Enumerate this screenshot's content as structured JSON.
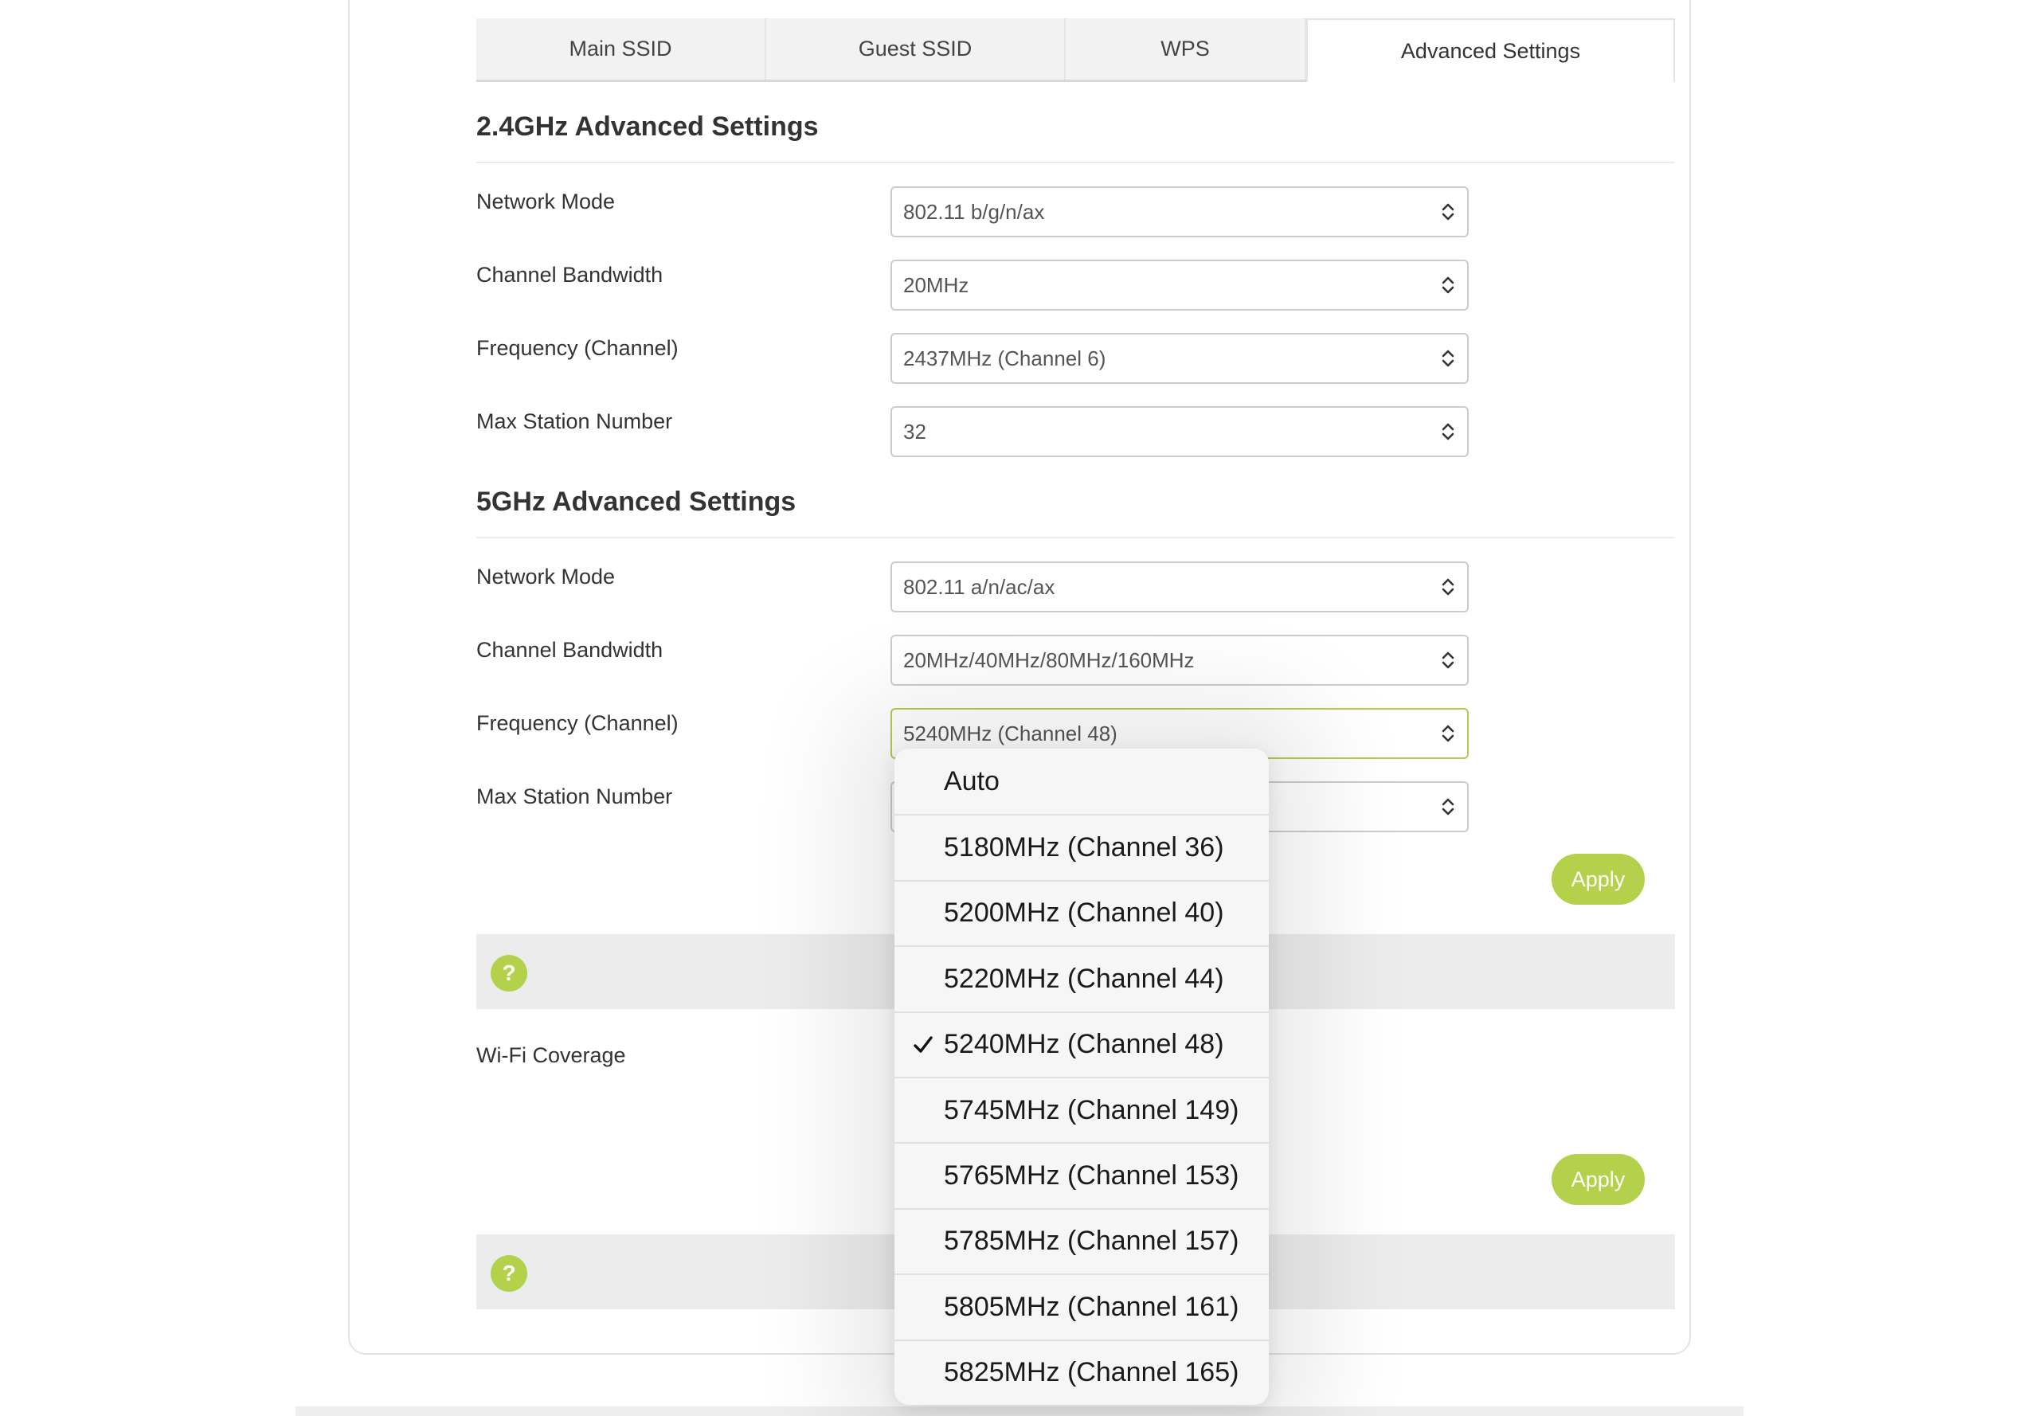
{
  "tabs": [
    {
      "label": "Main SSID"
    },
    {
      "label": "Guest SSID"
    },
    {
      "label": "WPS"
    },
    {
      "label": "Advanced Settings",
      "active": true
    }
  ],
  "band24": {
    "title": "2.4GHz Advanced Settings",
    "network_mode": {
      "label": "Network Mode",
      "value": "802.11 b/g/n/ax"
    },
    "channel_bandwidth": {
      "label": "Channel Bandwidth",
      "value": "20MHz"
    },
    "frequency": {
      "label": "Frequency (Channel)",
      "value": "2437MHz (Channel 6)"
    },
    "max_station": {
      "label": "Max Station Number",
      "value": "32"
    }
  },
  "band5": {
    "title": "5GHz Advanced Settings",
    "network_mode": {
      "label": "Network Mode",
      "value": "802.11 a/n/ac/ax"
    },
    "channel_bandwidth": {
      "label": "Channel Bandwidth",
      "value": "20MHz/40MHz/80MHz/160MHz"
    },
    "frequency": {
      "label": "Frequency (Channel)",
      "value": "5240MHz (Channel 48)"
    },
    "max_station": {
      "label": "Max Station Number",
      "value": ""
    }
  },
  "apply_label": "Apply",
  "wifi_coverage": {
    "label": "Wi-Fi Coverage"
  },
  "help_icon_glyph": "?",
  "frequency_dropdown": {
    "selected_index": 4,
    "options": [
      "Auto",
      "5180MHz (Channel 36)",
      "5200MHz (Channel 40)",
      "5220MHz (Channel 44)",
      "5240MHz (Channel 48)",
      "5745MHz (Channel 149)",
      "5765MHz (Channel 153)",
      "5785MHz (Channel 157)",
      "5805MHz (Channel 161)",
      "5825MHz (Channel 165)"
    ]
  },
  "colors": {
    "accent": "#b3d14a",
    "focus_border": "#b3cc4f",
    "help_bar": "#ececec",
    "tab_bar": "#f2f2f2"
  }
}
